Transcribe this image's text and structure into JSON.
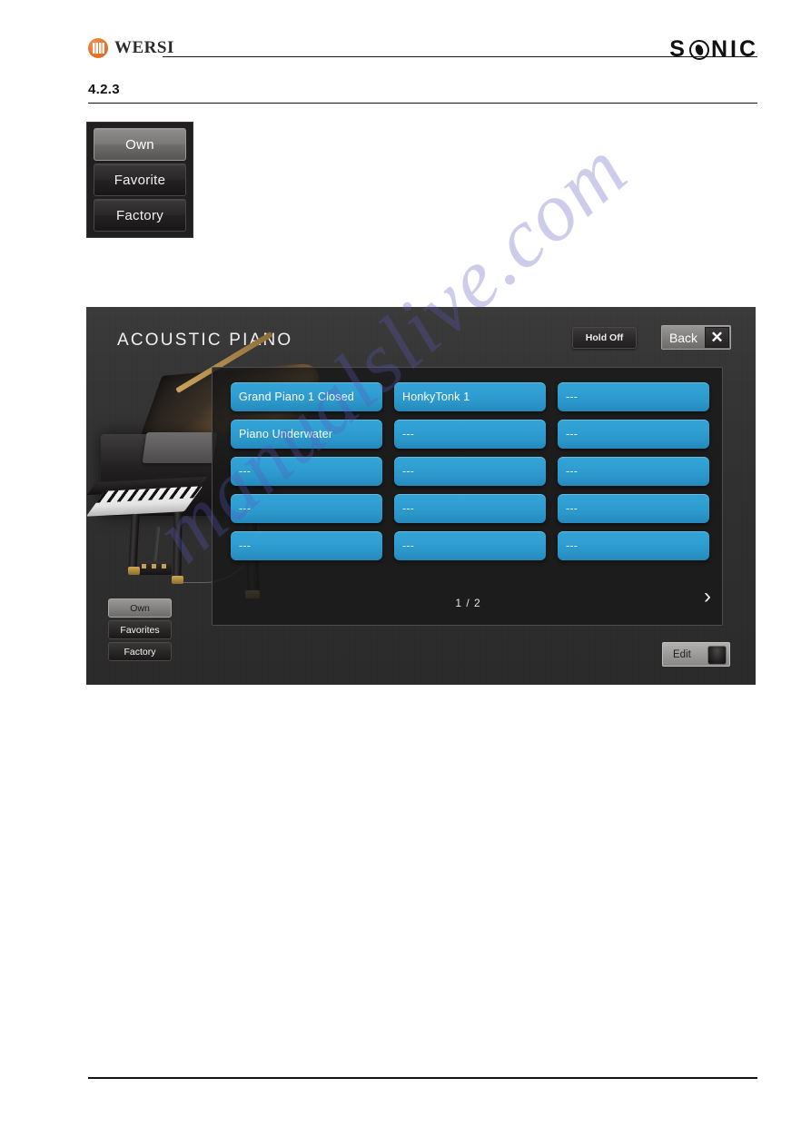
{
  "header": {
    "brand_text": "WERSI",
    "product_text_left": "S",
    "product_text_right": "NIC"
  },
  "section": {
    "number": "4.2.3"
  },
  "tab_panel": {
    "items": [
      {
        "label": "Own",
        "active": true
      },
      {
        "label": "Favorite",
        "active": false
      },
      {
        "label": "Factory",
        "active": false
      }
    ]
  },
  "screen": {
    "title": "ACOUSTIC PIANO",
    "hold_label": "Hold Off",
    "back_label": "Back",
    "close_label": "✕",
    "edit_label": "Edit",
    "page_indicator": "1 / 2",
    "next_arrow": "›",
    "tabs": [
      {
        "label": "Own",
        "active": true
      },
      {
        "label": "Favorites",
        "active": false
      },
      {
        "label": "Factory",
        "active": false
      }
    ],
    "sounds": [
      "Grand Piano 1 Closed",
      "HonkyTonk 1",
      "---",
      "Piano Underwater",
      "---",
      "---",
      "---",
      "---",
      "---",
      "---",
      "---",
      "---",
      "---",
      "---",
      "---"
    ]
  },
  "watermark": {
    "text": "manualslive.com"
  },
  "colors": {
    "accent_blue": "#2f9ed2",
    "brand_orange": "#e8732a",
    "screen_bg": "#343434",
    "panel_bg": "#211f1f"
  }
}
